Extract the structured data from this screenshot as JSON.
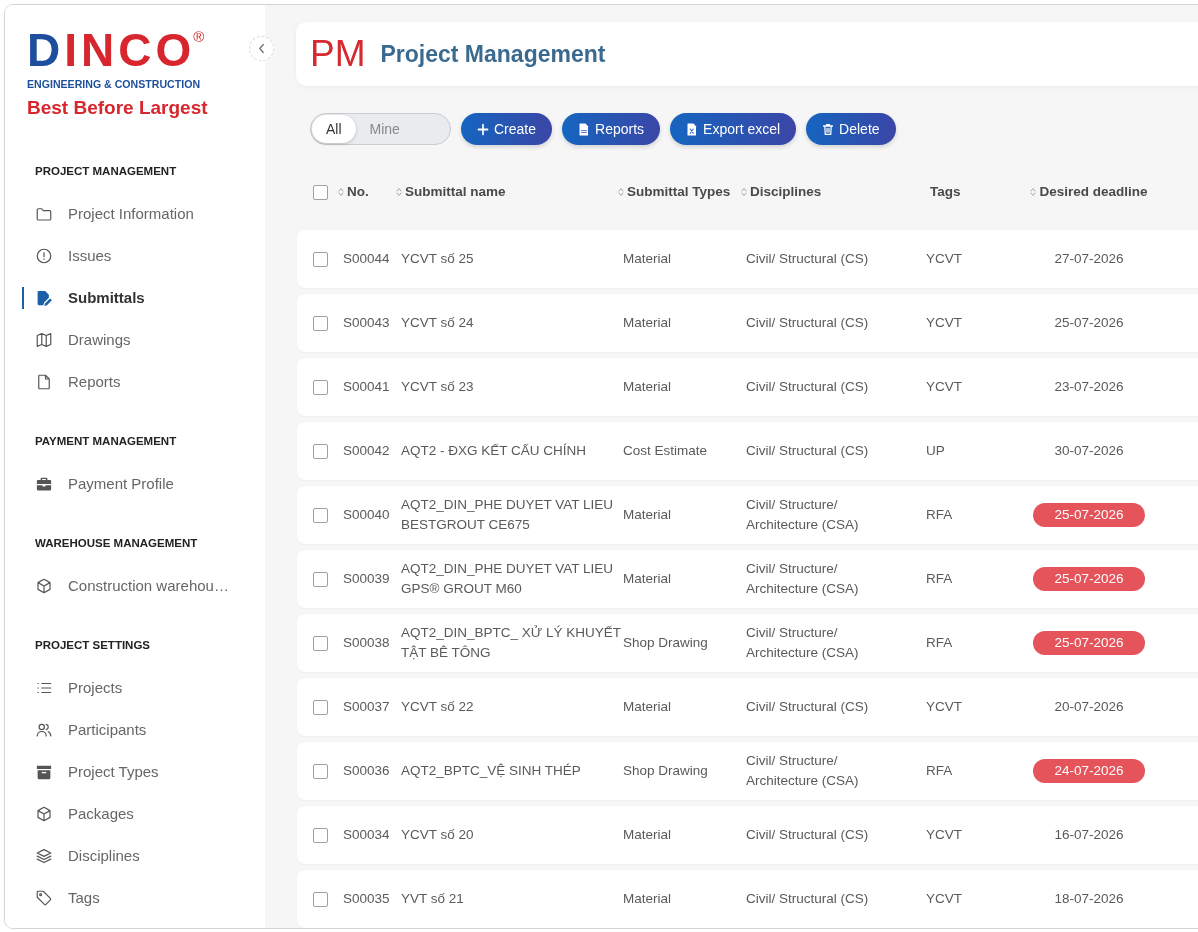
{
  "sidebar": {
    "logo": {
      "brand": "DINCO",
      "registered": "®",
      "tagline": "ENGINEERING & CONSTRUCTION",
      "slogan": "Best Before Largest"
    },
    "sections": [
      {
        "heading": "PROJECT MANAGEMENT",
        "items": [
          {
            "label": "Project Information",
            "selected": false
          },
          {
            "label": "Issues",
            "selected": false
          },
          {
            "label": "Submittals",
            "selected": true
          },
          {
            "label": "Drawings",
            "selected": false
          },
          {
            "label": "Reports",
            "selected": false
          }
        ]
      },
      {
        "heading": "PAYMENT MANAGEMENT",
        "items": [
          {
            "label": "Payment Profile",
            "selected": false
          }
        ]
      },
      {
        "heading": "WAREHOUSE MANAGEMENT",
        "items": [
          {
            "label": "Construction warehou…",
            "selected": false
          }
        ]
      },
      {
        "heading": "PROJECT SETTINGS",
        "items": [
          {
            "label": "Projects",
            "selected": false
          },
          {
            "label": "Participants",
            "selected": false
          },
          {
            "label": "Project Types",
            "selected": false
          },
          {
            "label": "Packages",
            "selected": false
          },
          {
            "label": "Disciplines",
            "selected": false
          },
          {
            "label": "Tags",
            "selected": false
          }
        ]
      }
    ]
  },
  "header": {
    "abbreviation": "PM",
    "title": "Project Management"
  },
  "toolbar": {
    "filters": [
      {
        "label": "All",
        "selected": true
      },
      {
        "label": "Mine",
        "selected": false
      }
    ],
    "buttons": [
      "Create",
      "Reports",
      "Export excel",
      "Delete"
    ]
  },
  "table": {
    "select_all_checked": false,
    "columns": [
      {
        "label": "No.",
        "sortable": true
      },
      {
        "label": "Submittal name",
        "sortable": true
      },
      {
        "label": "Submittal Types",
        "sortable": true
      },
      {
        "label": "Disciplines",
        "sortable": true
      },
      {
        "label": "Tags",
        "sortable": false
      },
      {
        "label": "Desired deadline",
        "sortable": true
      }
    ],
    "rows": [
      {
        "checked": false,
        "number": "S00044",
        "name": "YCVT số 25",
        "type": "Material",
        "discipline": "Civil/ Structural (CS)",
        "tag": "YCVT",
        "deadline": "27-07-2026",
        "overdue": false
      },
      {
        "checked": false,
        "number": "S00043",
        "name": "YCVT số 24",
        "type": "Material",
        "discipline": "Civil/ Structural (CS)",
        "tag": "YCVT",
        "deadline": "25-07-2026",
        "overdue": false
      },
      {
        "checked": false,
        "number": "S00041",
        "name": "YCVT số 23",
        "type": "Material",
        "discipline": "Civil/ Structural (CS)",
        "tag": "YCVT",
        "deadline": "23-07-2026",
        "overdue": false
      },
      {
        "checked": false,
        "number": "S00042",
        "name": "AQT2 - ĐXG KẾT CẤU CHÍNH",
        "type": "Cost Estimate",
        "discipline": "Civil/ Structural (CS)",
        "tag": "UP",
        "deadline": "30-07-2026",
        "overdue": false
      },
      {
        "checked": false,
        "number": "S00040",
        "name": "AQT2_DIN_PHE DUYET VAT LIEU BESTGROUT CE675",
        "type": "Material",
        "discipline": "Civil/ Structure/ Architecture (CSA)",
        "tag": "RFA",
        "deadline": "25-07-2026",
        "overdue": true
      },
      {
        "checked": false,
        "number": "S00039",
        "name": "AQT2_DIN_PHE DUYET VAT LIEU GPS® GROUT M60",
        "type": "Material",
        "discipline": "Civil/ Structure/ Architecture (CSA)",
        "tag": "RFA",
        "deadline": "25-07-2026",
        "overdue": true
      },
      {
        "checked": false,
        "number": "S00038",
        "name": "AQT2_DIN_BPTC_ XỬ LÝ KHUYẾT TẬT BÊ TÔNG",
        "type": "Shop Drawing",
        "discipline": "Civil/ Structure/ Architecture (CSA)",
        "tag": "RFA",
        "deadline": "25-07-2026",
        "overdue": true
      },
      {
        "checked": false,
        "number": "S00037",
        "name": "YCVT số 22",
        "type": "Material",
        "discipline": "Civil/ Structural (CS)",
        "tag": "YCVT",
        "deadline": "20-07-2026",
        "overdue": false
      },
      {
        "checked": false,
        "number": "S00036",
        "name": "AQT2_BPTC_VỆ SINH THÉP",
        "type": "Shop Drawing",
        "discipline": "Civil/ Structure/ Architecture (CSA)",
        "tag": "RFA",
        "deadline": "24-07-2026",
        "overdue": true
      },
      {
        "checked": false,
        "number": "S00034",
        "name": "YCVT số 20",
        "type": "Material",
        "discipline": "Civil/ Structural (CS)",
        "tag": "YCVT",
        "deadline": "16-07-2026",
        "overdue": false
      },
      {
        "checked": false,
        "number": "S00035",
        "name": "YVT số 21",
        "type": "Material",
        "discipline": "Civil/ Structural (CS)",
        "tag": "YCVT",
        "deadline": "18-07-2026",
        "overdue": false
      }
    ]
  }
}
